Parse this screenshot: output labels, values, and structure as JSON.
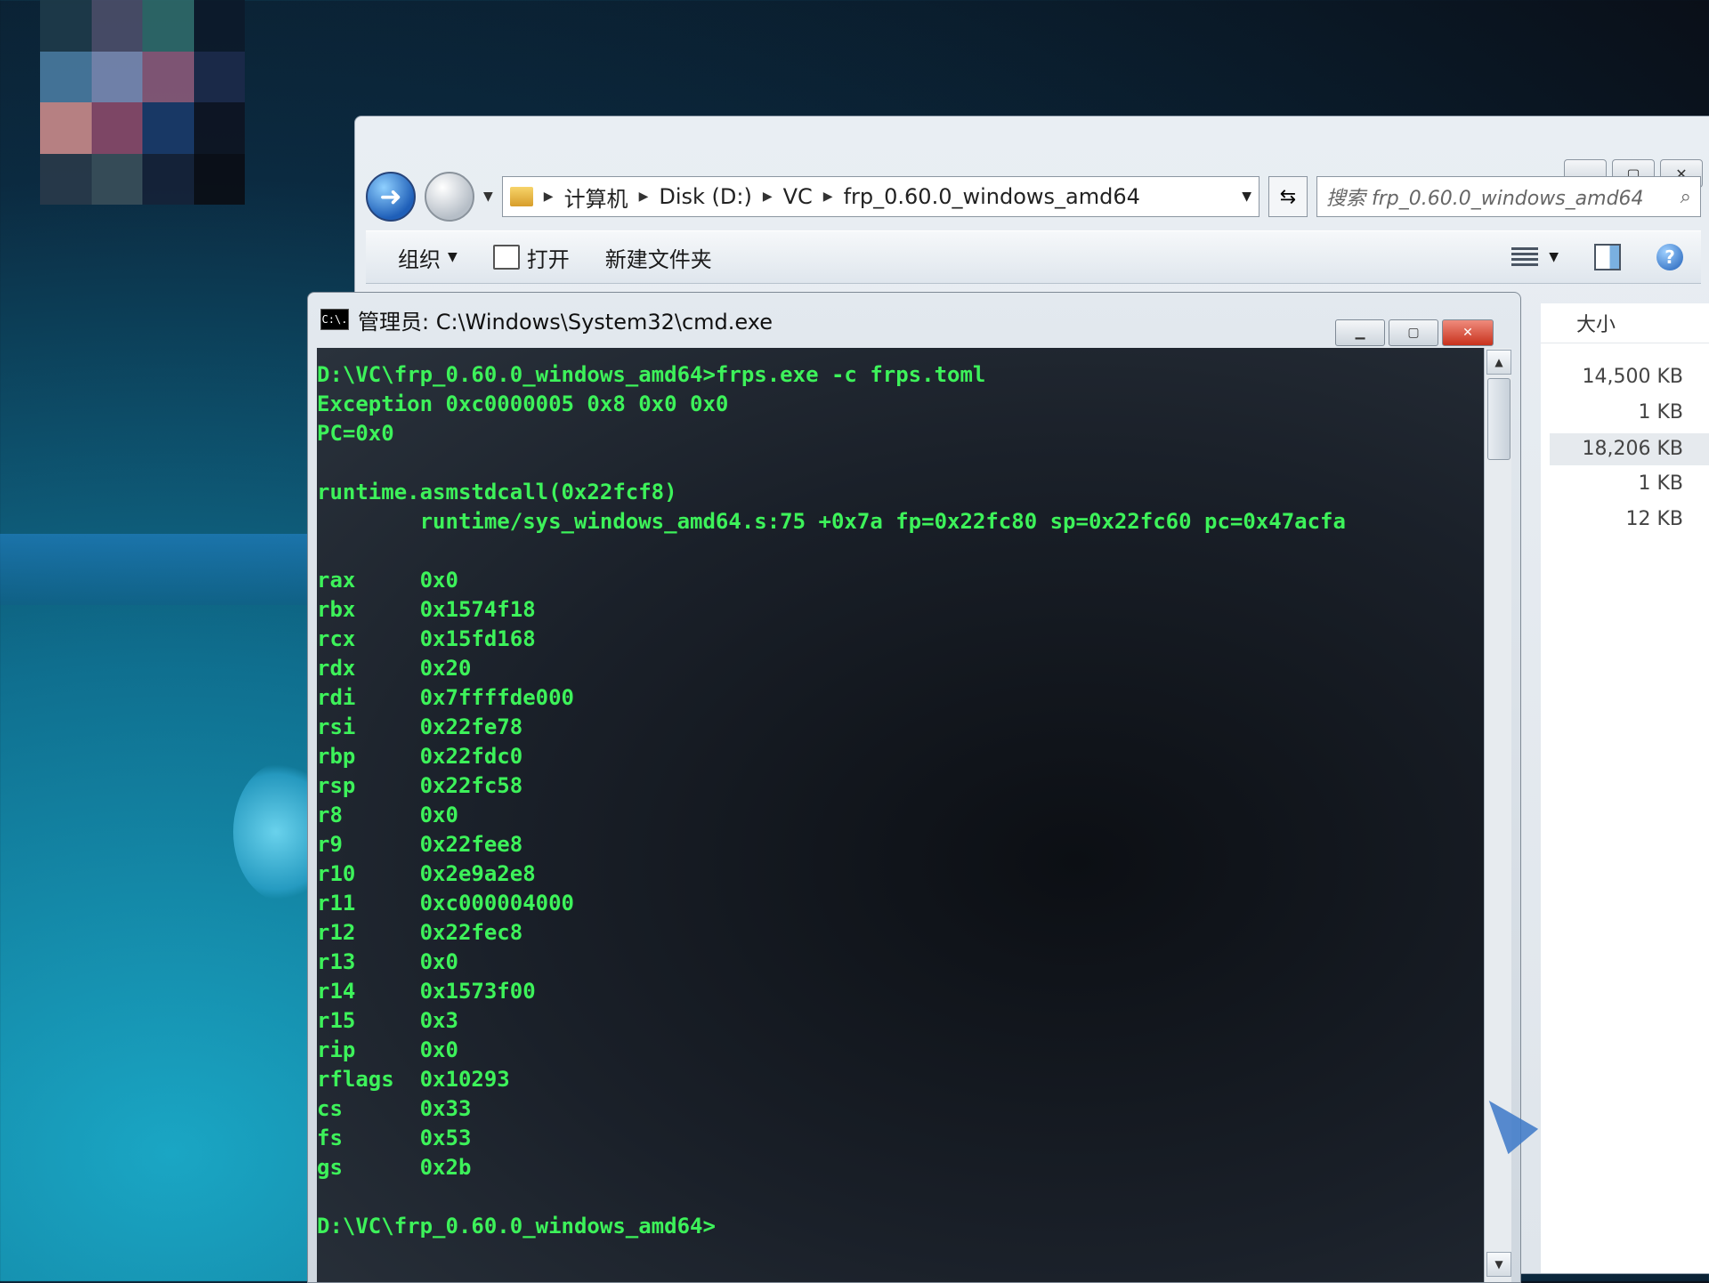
{
  "explorer": {
    "breadcrumbs": [
      "计算机",
      "Disk (D:)",
      "VC",
      "frp_0.60.0_windows_amd64"
    ],
    "search_placeholder": "搜索 frp_0.60.0_windows_amd64",
    "toolbar": {
      "organize": "组织",
      "open": "打开",
      "new_folder": "新建文件夹"
    },
    "column_header": "大小",
    "sizes": [
      "14,500 KB",
      "1 KB",
      "18,206 KB",
      "1 KB",
      "12 KB"
    ]
  },
  "cmd": {
    "title": "管理员: C:\\Windows\\System32\\cmd.exe",
    "icon_text": "C:\\.",
    "lines": [
      "D:\\VC\\frp_0.60.0_windows_amd64>frps.exe -c frps.toml",
      "Exception 0xc0000005 0x8 0x0 0x0",
      "PC=0x0",
      "",
      "runtime.asmstdcall(0x22fcf8)",
      "        runtime/sys_windows_amd64.s:75 +0x7a fp=0x22fc80 sp=0x22fc60 pc=0x47acfa",
      "",
      "rax     0x0",
      "rbx     0x1574f18",
      "rcx     0x15fd168",
      "rdx     0x20",
      "rdi     0x7ffffde000",
      "rsi     0x22fe78",
      "rbp     0x22fdc0",
      "rsp     0x22fc58",
      "r8      0x0",
      "r9      0x22fee8",
      "r10     0x2e9a2e8",
      "r11     0xc000004000",
      "r12     0x22fec8",
      "r13     0x0",
      "r14     0x1573f00",
      "r15     0x3",
      "rip     0x0",
      "rflags  0x10293",
      "cs      0x33",
      "fs      0x53",
      "gs      0x2b",
      "",
      "D:\\VC\\frp_0.60.0_windows_amd64>"
    ]
  },
  "colors": {
    "console_text": "#3df25a",
    "close_button": "#c8321d"
  }
}
